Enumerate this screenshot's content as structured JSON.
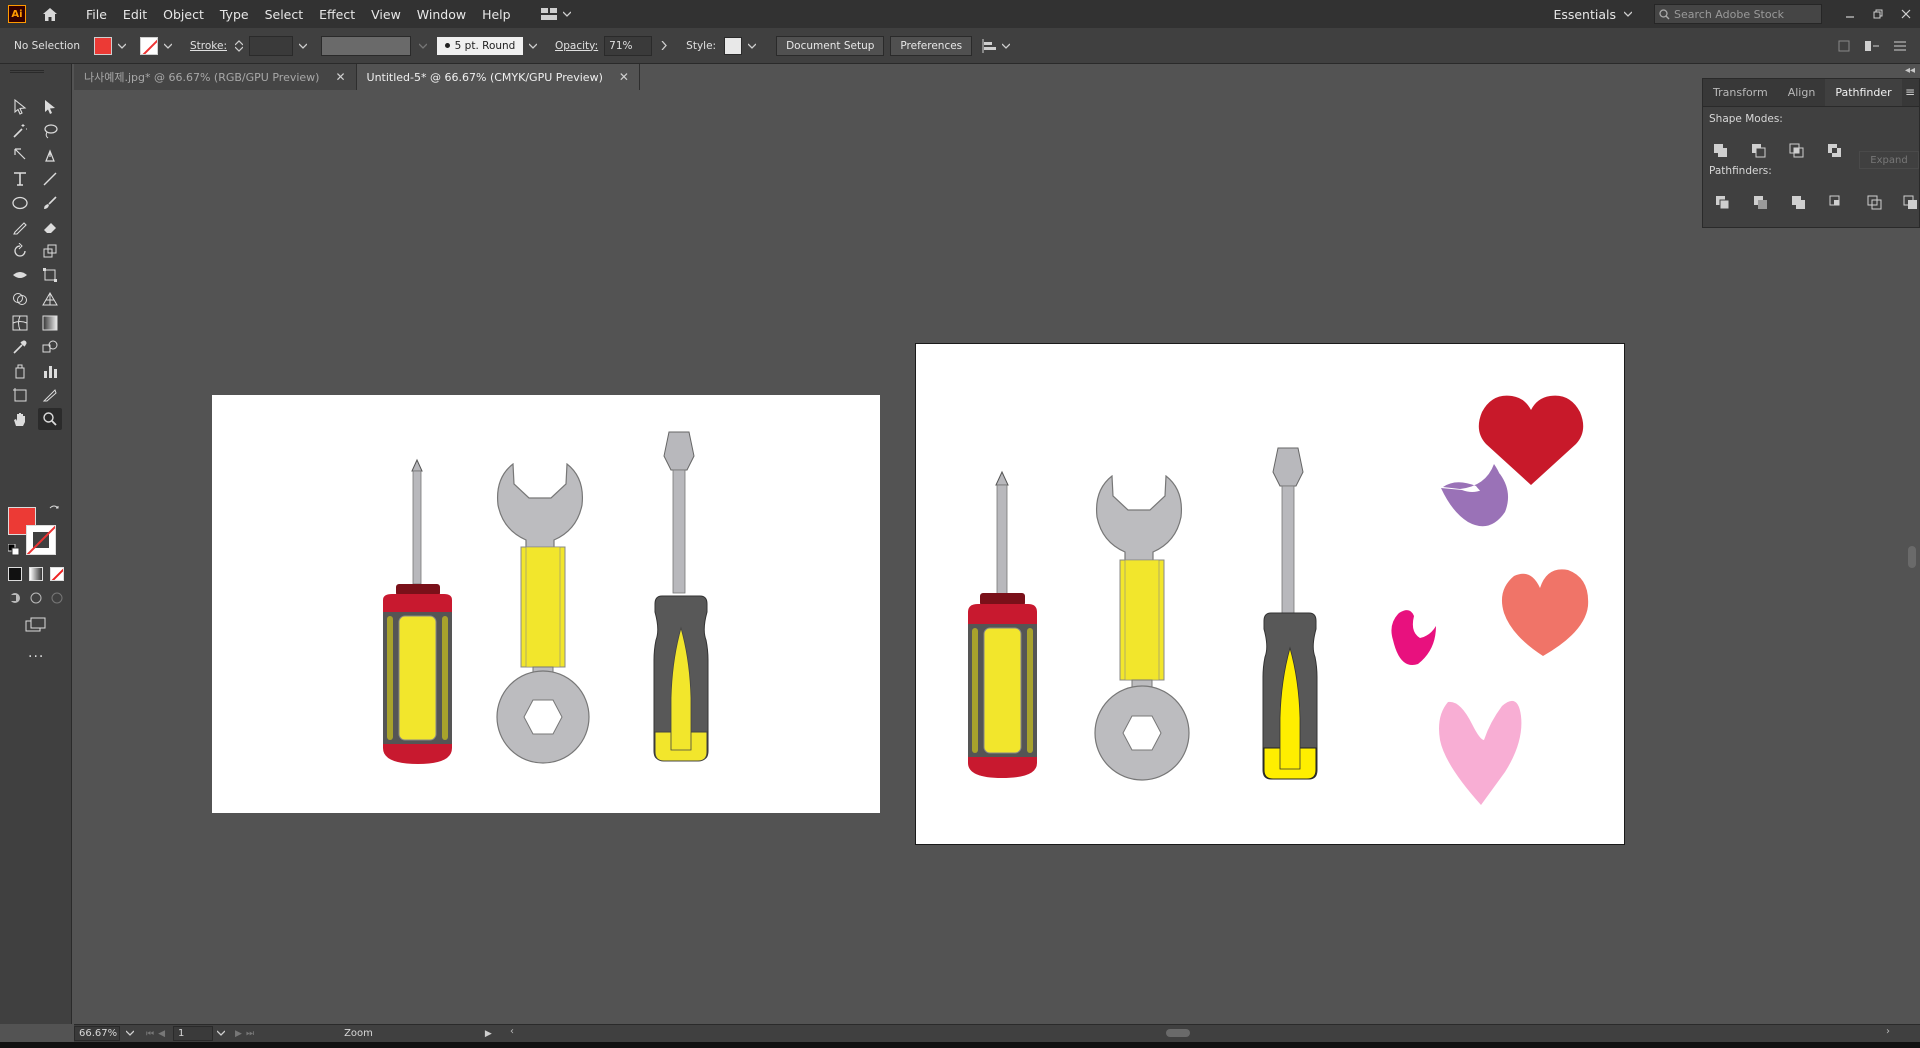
{
  "app": {
    "logo": "Ai",
    "menus": [
      "File",
      "Edit",
      "Object",
      "Type",
      "Select",
      "Effect",
      "View",
      "Window",
      "Help"
    ],
    "workspace": "Essentials",
    "search_placeholder": "Search Adobe Stock"
  },
  "control_bar": {
    "selection": "No Selection",
    "stroke_label": "Stroke:",
    "brush": "5 pt. Round",
    "opacity_label": "Opacity:",
    "opacity_value": "71%",
    "style_label": "Style:",
    "document_setup": "Document Setup",
    "preferences": "Preferences"
  },
  "tabs": [
    {
      "label": "나사예제.jpg* @ 66.67% (RGB/GPU Preview)",
      "active": false
    },
    {
      "label": "Untitled-5* @ 66.67% (CMYK/GPU Preview)",
      "active": true
    }
  ],
  "panel": {
    "tabs": [
      "Transform",
      "Align",
      "Pathfinder"
    ],
    "active_tab": "Pathfinder",
    "shape_modes_label": "Shape Modes:",
    "pathfinders_label": "Pathfinders:",
    "expand_label": "Expand"
  },
  "status": {
    "zoom": "66.67%",
    "artboard": "1",
    "tool": "Zoom"
  },
  "colors": {
    "fill": "#ec3a35",
    "stroke": "none"
  }
}
